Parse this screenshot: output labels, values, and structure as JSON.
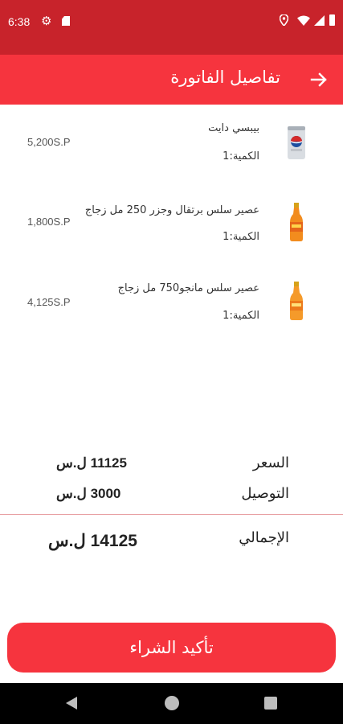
{
  "status_bar": {
    "time": "6:38"
  },
  "header": {
    "title": "تفاصيل الفاتورة",
    "back_icon": "arrow-right-icon"
  },
  "items": [
    {
      "name": "بيبسي دايت",
      "quantity": "الكمية:1",
      "price": "5,200S.P",
      "image": "pepsi-can"
    },
    {
      "name": "عصير سلس برتقال وجزر 250 مل زجاج",
      "quantity": "الكمية:1",
      "price": "1,800S.P",
      "image": "orange-bottle"
    },
    {
      "name": "عصير سلس مانجو750 مل زجاج",
      "quantity": "الكمية:1",
      "price": "4,125S.P",
      "image": "mango-bottle"
    }
  ],
  "summary": {
    "price_label": "السعر",
    "price_value": "11125 ل.س",
    "delivery_label": "التوصيل",
    "delivery_value": "3000 ل.س",
    "total_label": "الإجمالي",
    "total_value": "14125 ل.س"
  },
  "confirm_button": {
    "label": "تأكيد الشراء"
  },
  "colors": {
    "primary": "#f6343e",
    "status_bar": "#c8232b",
    "divider": "#e8a0a3"
  }
}
